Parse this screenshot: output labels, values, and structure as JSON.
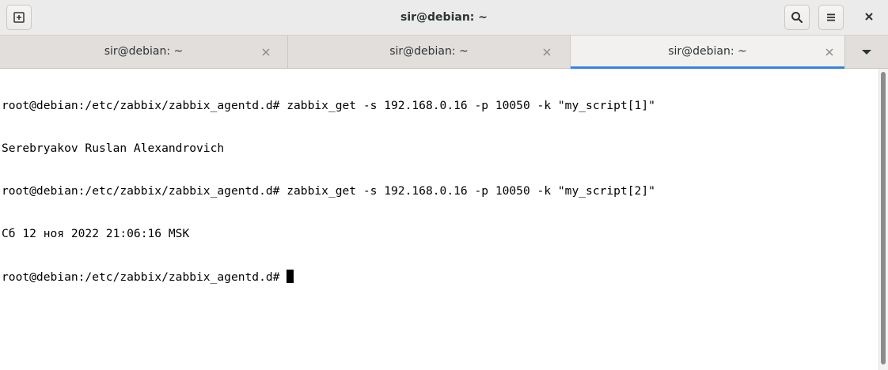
{
  "window": {
    "title": "sir@debian: ~"
  },
  "header": {
    "new_tab_icon": "new-tab-icon",
    "search_icon": "search-icon",
    "menu_icon": "hamburger-menu-icon",
    "close_icon": "close-icon"
  },
  "tabs": [
    {
      "label": "sir@debian: ~",
      "active": false
    },
    {
      "label": "sir@debian: ~",
      "active": false
    },
    {
      "label": "sir@debian: ~",
      "active": true
    }
  ],
  "terminal": {
    "lines": [
      "root@debian:/etc/zabbix/zabbix_agentd.d# zabbix_get -s 192.168.0.16 -p 10050 -k \"my_script[1]\"",
      "Serebryakov Ruslan Alexandrovich",
      "root@debian:/etc/zabbix/zabbix_agentd.d# zabbix_get -s 192.168.0.16 -p 10050 -k \"my_script[2]\"",
      "Сб 12 ноя 2022 21:06:16 MSK",
      "root@debian:/etc/zabbix/zabbix_agentd.d# "
    ]
  },
  "colors": {
    "accent": "#3584e4",
    "header_bg": "#ebebeb",
    "tabbar_bg": "#e1dedb",
    "terminal_bg": "#ffffff",
    "terminal_fg": "#000000"
  }
}
